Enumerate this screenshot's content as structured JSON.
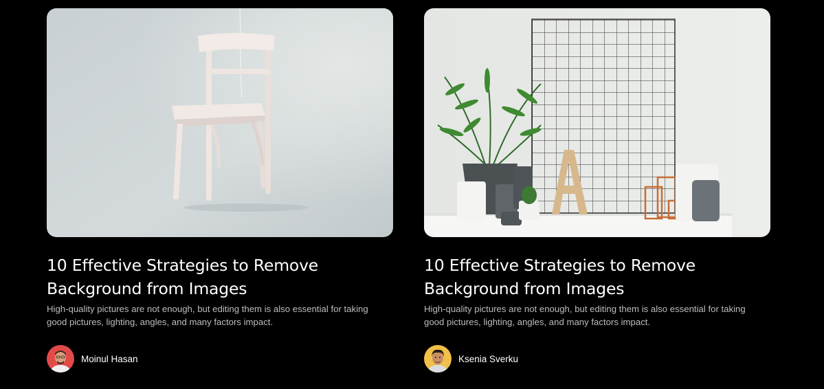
{
  "posts": [
    {
      "image": "white-chair-photo",
      "title": "10 Effective Strategies to Remove Background from Images",
      "excerpt": "High-quality pictures are not enough, but editing them is also essential for taking good pictures, lighting, angles, and many factors impact.",
      "author": {
        "name": "Moinul Hasan",
        "avatar": "avatar-red-background"
      }
    },
    {
      "image": "plant-grid-letter-a-photo",
      "title": "10 Effective Strategies to Remove Background from Images",
      "excerpt": "High-quality pictures are not enough, but editing them is also essential for taking good pictures, lighting, angles, and many factors impact.",
      "author": {
        "name": "Ksenia Sverku",
        "avatar": "avatar-yellow-background"
      }
    }
  ],
  "colors": {
    "page_background": "#000000",
    "title_text": "#ffffff",
    "excerpt_text": "#bdbdbd"
  }
}
